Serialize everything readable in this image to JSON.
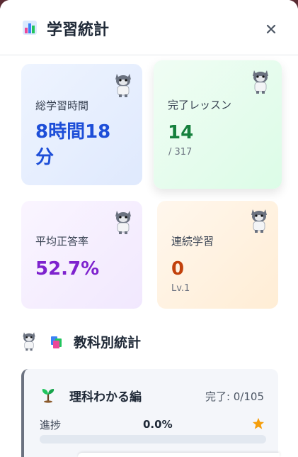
{
  "header": {
    "title": "学習統計",
    "icon": "bar-chart-icon",
    "close_label": "×"
  },
  "stats": {
    "total_time": {
      "label": "総学習時間",
      "value_line1": "8時間18",
      "value_line2": "分",
      "color": "#1d4ed8"
    },
    "completed": {
      "label": "完了レッスン",
      "value": "14",
      "sub": "/ 317",
      "color": "#15803d"
    },
    "accuracy": {
      "label": "平均正答率",
      "value": "52.7%",
      "color": "#7e22ce"
    },
    "streak": {
      "label": "連続学習",
      "value": "0",
      "sub": "Lv.1",
      "color": "#c2410c"
    }
  },
  "subjects_section": {
    "title": "教科別統計",
    "icon": "books-icon"
  },
  "subjects": [
    {
      "name": "理科わかる編",
      "icon": "sprout-icon",
      "completed_text": "完了: 0/105",
      "progress_label": "進捗",
      "progress_value": "0.0%",
      "progress_fraction": 0.0,
      "badge_icon": "star-icon"
    }
  ]
}
